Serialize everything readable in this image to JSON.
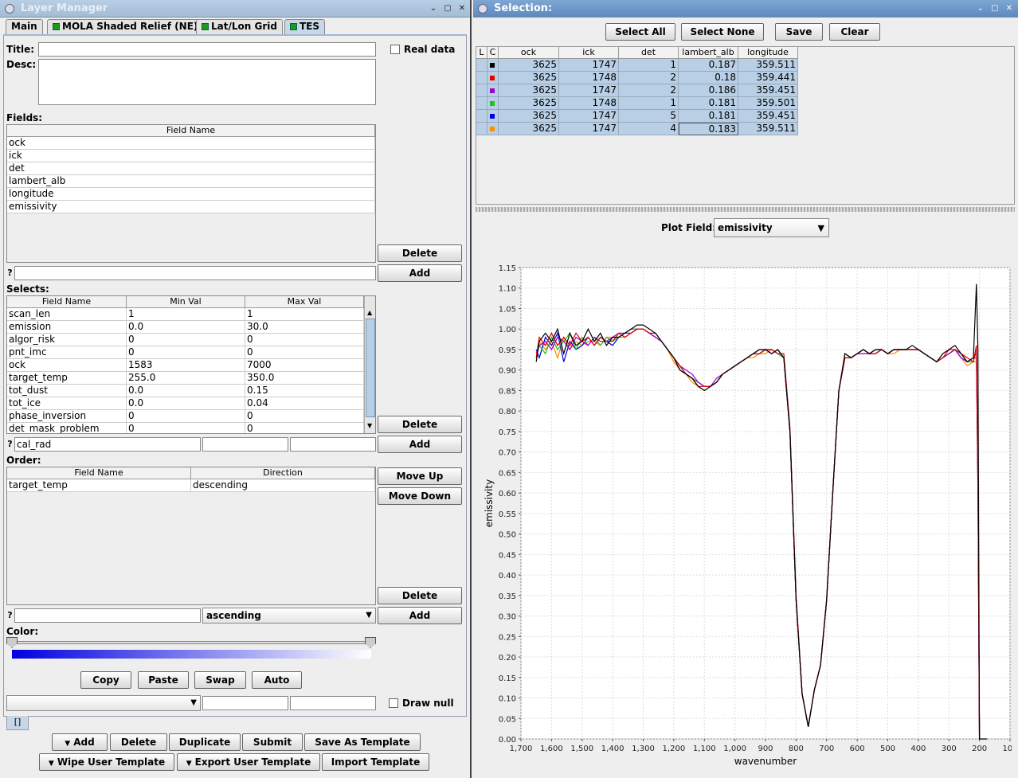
{
  "left_window": {
    "title": "Layer Manager",
    "tabs": [
      {
        "label": "Main",
        "indicator": false
      },
      {
        "label": "MOLA Shaded Relief (NE)",
        "indicator": true
      },
      {
        "label": "Lat/Lon Grid",
        "indicator": true
      },
      {
        "label": "TES",
        "indicator": true
      }
    ],
    "title_label": "Title:",
    "title_value": "",
    "real_data_label": "Real data",
    "desc_label": "Desc:",
    "fields_label": "Fields:",
    "fields_header": "Field Name",
    "fields": [
      "ock",
      "ick",
      "det",
      "lambert_alb",
      "longitude",
      "emissivity"
    ],
    "fields_delete": "Delete",
    "fields_add": "Add",
    "help_glyph": "?",
    "selects_label": "Selects:",
    "selects_headers": [
      "Field Name",
      "Min Val",
      "Max Val"
    ],
    "selects_rows": [
      [
        "scan_len",
        "1",
        "1"
      ],
      [
        "emission",
        "0.0",
        "30.0"
      ],
      [
        "algor_risk",
        "0",
        "0"
      ],
      [
        "pnt_imc",
        "0",
        "0"
      ],
      [
        "ock",
        "1583",
        "7000"
      ],
      [
        "target_temp",
        "255.0",
        "350.0"
      ],
      [
        "tot_dust",
        "0.0",
        "0.15"
      ],
      [
        "tot_ice",
        "0.0",
        "0.04"
      ],
      [
        "phase_inversion",
        "0",
        "0"
      ],
      [
        "det_mask_problem",
        "0",
        "0"
      ]
    ],
    "selects_delete": "Delete",
    "selects_add": "Add",
    "selects_input_field": "cal_rad",
    "order_label": "Order:",
    "order_headers": [
      "Field Name",
      "Direction"
    ],
    "order_rows": [
      [
        "target_temp",
        "descending"
      ]
    ],
    "order_move_up": "Move Up",
    "order_move_down": "Move Down",
    "order_delete": "Delete",
    "order_add": "Add",
    "order_direction_selected": "ascending",
    "color_label": "Color:",
    "color_buttons": [
      "Copy",
      "Paste",
      "Swap",
      "Auto"
    ],
    "draw_null_label": "Draw null",
    "bottom_tab_label": "[]",
    "bottom_row1": [
      "Add",
      "Delete",
      "Duplicate",
      "Submit",
      "Save As Template"
    ],
    "bottom_row2": [
      "Wipe User Template",
      "Export User Template",
      "Import Template"
    ],
    "colors": {
      "gradient_start": "#0000e0",
      "gradient_end": "#ffffff"
    }
  },
  "right_window": {
    "title": "Selection:",
    "buttons": [
      "Select All",
      "Select None",
      "Save",
      "Clear"
    ],
    "table_headers": [
      "L",
      "C",
      "ock",
      "ick",
      "det",
      "lambert_alb",
      "longitude"
    ],
    "table_rows": [
      {
        "color": "#000000",
        "cells": [
          "3625",
          "1747",
          "1",
          "0.187",
          "359.511"
        ]
      },
      {
        "color": "#e00000",
        "cells": [
          "3625",
          "1748",
          "2",
          "0.18",
          "359.441"
        ]
      },
      {
        "color": "#9a00d0",
        "cells": [
          "3625",
          "1747",
          "2",
          "0.186",
          "359.451"
        ]
      },
      {
        "color": "#20c020",
        "cells": [
          "3625",
          "1748",
          "1",
          "0.181",
          "359.501"
        ]
      },
      {
        "color": "#0000e0",
        "cells": [
          "3625",
          "1747",
          "5",
          "0.181",
          "359.451"
        ]
      },
      {
        "color": "#ff8c00",
        "cells": [
          "3625",
          "1747",
          "4",
          "0.183",
          "359.511"
        ]
      }
    ],
    "plot_field_label": "Plot Field:",
    "plot_field_value": "emissivity"
  },
  "chart_data": {
    "type": "line",
    "xlabel": "wavenumber",
    "ylabel": "emissivity",
    "xlim": [
      1700,
      100
    ],
    "ylim": [
      0,
      1.15
    ],
    "x_reversed": true,
    "xticks": [
      "1,700",
      "1,600",
      "1,500",
      "1,400",
      "1,300",
      "1,200",
      "1,100",
      "1,000",
      "900",
      "800",
      "700",
      "600",
      "500",
      "400",
      "300",
      "200",
      "100"
    ],
    "yticks": [
      "0.00",
      "0.05",
      "0.10",
      "0.15",
      "0.20",
      "0.25",
      "0.30",
      "0.35",
      "0.40",
      "0.45",
      "0.50",
      "0.55",
      "0.60",
      "0.65",
      "0.70",
      "0.75",
      "0.80",
      "0.85",
      "0.90",
      "0.95",
      "1.00",
      "1.05",
      "1.10",
      "1.15"
    ],
    "grid": true,
    "series": [
      {
        "color": "#000000",
        "x": [
          1650,
          1640,
          1620,
          1600,
          1580,
          1560,
          1540,
          1520,
          1500,
          1480,
          1460,
          1440,
          1420,
          1400,
          1380,
          1360,
          1340,
          1320,
          1300,
          1280,
          1260,
          1240,
          1220,
          1200,
          1180,
          1160,
          1140,
          1120,
          1100,
          1080,
          1060,
          1040,
          1020,
          1000,
          980,
          960,
          940,
          920,
          900,
          880,
          860,
          840,
          820,
          800,
          780,
          760,
          740,
          720,
          700,
          680,
          660,
          640,
          620,
          600,
          580,
          560,
          540,
          520,
          500,
          480,
          460,
          440,
          420,
          400,
          380,
          360,
          340,
          320,
          300,
          280,
          260,
          240,
          220,
          210,
          205,
          200,
          195,
          190,
          185,
          180,
          175
        ],
        "y": [
          0.92,
          0.97,
          0.99,
          0.97,
          1.0,
          0.94,
          0.99,
          0.96,
          0.97,
          1.0,
          0.97,
          0.99,
          0.96,
          0.98,
          0.98,
          0.99,
          1.0,
          1.01,
          1.01,
          1.0,
          0.99,
          0.97,
          0.95,
          0.93,
          0.9,
          0.89,
          0.88,
          0.86,
          0.85,
          0.86,
          0.87,
          0.89,
          0.9,
          0.91,
          0.92,
          0.93,
          0.94,
          0.95,
          0.95,
          0.94,
          0.95,
          0.93,
          0.75,
          0.34,
          0.11,
          0.03,
          0.12,
          0.18,
          0.34,
          0.6,
          0.85,
          0.94,
          0.93,
          0.94,
          0.95,
          0.94,
          0.95,
          0.95,
          0.94,
          0.95,
          0.95,
          0.95,
          0.96,
          0.95,
          0.94,
          0.93,
          0.92,
          0.94,
          0.95,
          0.96,
          0.94,
          0.92,
          0.93,
          1.11,
          0.95,
          0.0,
          0.0,
          0.0,
          0.0,
          0.0,
          0.0
        ]
      },
      {
        "color": "#e00000",
        "x": [
          1650,
          1640,
          1620,
          1600,
          1580,
          1560,
          1540,
          1520,
          1500,
          1480,
          1460,
          1440,
          1420,
          1400,
          1380,
          1360,
          1340,
          1320,
          1300,
          1280,
          1260,
          1240,
          1220,
          1200,
          1180,
          1160,
          1140,
          1120,
          1100,
          1080,
          1060,
          1040,
          1020,
          1000,
          980,
          960,
          940,
          920,
          900,
          880,
          860,
          840,
          820,
          800,
          780,
          760,
          740,
          720,
          700,
          680,
          660,
          640,
          620,
          600,
          580,
          560,
          540,
          520,
          500,
          480,
          460,
          440,
          420,
          400,
          380,
          360,
          340,
          320,
          300,
          280,
          260,
          240,
          220,
          210,
          205,
          200
        ],
        "y": [
          0.93,
          0.98,
          0.96,
          0.99,
          0.96,
          0.98,
          0.96,
          0.99,
          0.97,
          0.98,
          0.96,
          0.98,
          0.97,
          0.97,
          0.99,
          0.98,
          0.99,
          1.0,
          1.0,
          0.99,
          0.99,
          0.97,
          0.95,
          0.93,
          0.91,
          0.89,
          0.88,
          0.86,
          0.86,
          0.86,
          0.87,
          0.89,
          0.9,
          0.91,
          0.92,
          0.93,
          0.94,
          0.94,
          0.95,
          0.95,
          0.94,
          0.94,
          0.76,
          0.35,
          0.11,
          0.03,
          0.12,
          0.18,
          0.34,
          0.6,
          0.85,
          0.93,
          0.93,
          0.94,
          0.95,
          0.94,
          0.94,
          0.95,
          0.94,
          0.95,
          0.95,
          0.95,
          0.95,
          0.95,
          0.94,
          0.93,
          0.92,
          0.93,
          0.95,
          0.95,
          0.94,
          0.93,
          0.92,
          0.96,
          0.6,
          0.0
        ]
      },
      {
        "color": "#9a00d0",
        "x": [
          1650,
          1640,
          1620,
          1600,
          1580,
          1560,
          1540,
          1520,
          1500,
          1480,
          1460,
          1440,
          1420,
          1400,
          1380,
          1360,
          1340,
          1320,
          1300,
          1280,
          1260,
          1240,
          1220,
          1200,
          1180,
          1160,
          1140,
          1120,
          1100,
          1080,
          1060,
          1040,
          1020,
          1000,
          980,
          960,
          940,
          920,
          900,
          880,
          860,
          840,
          820,
          800,
          780,
          760,
          740,
          720,
          700,
          680,
          660,
          640,
          620,
          600,
          580,
          560,
          540,
          520,
          500,
          480,
          460,
          440,
          420,
          400,
          380,
          360,
          340,
          320,
          300,
          280,
          260,
          240,
          220,
          210,
          205,
          200
        ],
        "y": [
          0.94,
          0.96,
          0.97,
          0.95,
          0.98,
          0.97,
          0.95,
          0.98,
          0.97,
          0.96,
          0.98,
          0.97,
          0.97,
          0.98,
          0.99,
          0.99,
          0.99,
          1.0,
          1.0,
          0.99,
          0.98,
          0.97,
          0.95,
          0.93,
          0.91,
          0.9,
          0.89,
          0.87,
          0.86,
          0.86,
          0.88,
          0.89,
          0.9,
          0.91,
          0.92,
          0.93,
          0.94,
          0.95,
          0.95,
          0.94,
          0.95,
          0.93,
          0.75,
          0.34,
          0.11,
          0.03,
          0.12,
          0.18,
          0.34,
          0.6,
          0.85,
          0.94,
          0.93,
          0.94,
          0.94,
          0.94,
          0.95,
          0.95,
          0.94,
          0.95,
          0.95,
          0.95,
          0.95,
          0.95,
          0.94,
          0.93,
          0.92,
          0.93,
          0.94,
          0.95,
          0.93,
          0.92,
          0.93,
          0.94,
          0.65,
          0.0
        ]
      },
      {
        "color": "#20c020",
        "x": [
          1650,
          1640,
          1620,
          1600,
          1580,
          1560,
          1540,
          1520,
          1500,
          1480,
          1460,
          1440,
          1420,
          1400,
          1380,
          1360,
          1340,
          1320,
          1300,
          1280,
          1260,
          1240,
          1220,
          1200,
          1180,
          1160,
          1140,
          1120,
          1100,
          1080,
          1060,
          1040,
          1020,
          1000,
          980,
          960,
          940,
          920,
          900,
          880,
          860,
          840,
          820,
          800,
          780,
          760,
          740,
          720,
          700,
          680,
          660,
          640,
          620,
          600,
          580,
          560,
          540,
          520,
          500,
          480,
          460,
          440,
          420,
          400,
          380,
          360,
          340,
          320,
          300,
          280,
          260,
          240,
          220,
          210,
          205,
          200
        ],
        "y": [
          0.93,
          0.96,
          0.94,
          0.98,
          0.95,
          0.97,
          0.99,
          0.95,
          0.98,
          0.96,
          0.98,
          0.96,
          0.98,
          0.97,
          0.98,
          0.99,
          1.0,
          1.0,
          1.0,
          0.99,
          0.98,
          0.97,
          0.95,
          0.93,
          0.9,
          0.89,
          0.88,
          0.87,
          0.86,
          0.86,
          0.87,
          0.89,
          0.9,
          0.91,
          0.92,
          0.93,
          0.94,
          0.94,
          0.95,
          0.95,
          0.94,
          0.93,
          0.75,
          0.34,
          0.11,
          0.03,
          0.12,
          0.18,
          0.34,
          0.6,
          0.85,
          0.93,
          0.93,
          0.94,
          0.95,
          0.94,
          0.95,
          0.95,
          0.94,
          0.95,
          0.95,
          0.95,
          0.95,
          0.95,
          0.94,
          0.93,
          0.92,
          0.93,
          0.94,
          0.95,
          0.94,
          0.92,
          0.92,
          0.95,
          0.7,
          0.0
        ]
      },
      {
        "color": "#0000e0",
        "x": [
          1650,
          1640,
          1620,
          1600,
          1580,
          1560,
          1540,
          1520,
          1500,
          1480,
          1460,
          1440,
          1420,
          1400,
          1380,
          1360,
          1340,
          1320,
          1300,
          1280,
          1260,
          1240,
          1220,
          1200,
          1180,
          1160,
          1140,
          1120,
          1100,
          1080,
          1060,
          1040,
          1020,
          1000,
          980,
          960,
          940,
          920,
          900,
          880,
          860,
          840,
          820,
          800,
          780,
          760,
          740,
          720,
          700,
          680,
          660,
          640,
          620,
          600,
          580,
          560,
          540,
          520,
          500,
          480,
          460,
          440,
          420,
          400,
          380,
          360,
          340,
          320,
          300,
          280,
          260,
          240,
          220,
          210,
          205,
          200
        ],
        "y": [
          0.95,
          0.93,
          0.98,
          0.96,
          0.99,
          0.92,
          0.97,
          0.95,
          0.96,
          0.98,
          0.96,
          0.98,
          0.97,
          0.96,
          0.98,
          0.99,
          1.0,
          1.0,
          1.0,
          0.99,
          0.98,
          0.97,
          0.95,
          0.93,
          0.91,
          0.89,
          0.88,
          0.87,
          0.86,
          0.86,
          0.87,
          0.89,
          0.9,
          0.91,
          0.92,
          0.93,
          0.94,
          0.94,
          0.95,
          0.95,
          0.94,
          0.93,
          0.75,
          0.34,
          0.11,
          0.03,
          0.12,
          0.18,
          0.34,
          0.6,
          0.85,
          0.93,
          0.93,
          0.94,
          0.95,
          0.94,
          0.94,
          0.95,
          0.94,
          0.95,
          0.95,
          0.95,
          0.95,
          0.95,
          0.94,
          0.93,
          0.92,
          0.93,
          0.94,
          0.95,
          0.93,
          0.92,
          0.93,
          0.93,
          0.62,
          0.0
        ]
      },
      {
        "color": "#ff8c00",
        "x": [
          1650,
          1640,
          1620,
          1600,
          1580,
          1560,
          1540,
          1520,
          1500,
          1480,
          1460,
          1440,
          1420,
          1400,
          1380,
          1360,
          1340,
          1320,
          1300,
          1280,
          1260,
          1240,
          1220,
          1200,
          1180,
          1160,
          1140,
          1120,
          1100,
          1080,
          1060,
          1040,
          1020,
          1000,
          980,
          960,
          940,
          920,
          900,
          880,
          860,
          840,
          820,
          800,
          780,
          760,
          740,
          720,
          700,
          680,
          660,
          640,
          620,
          600,
          580,
          560,
          540,
          520,
          500,
          480,
          460,
          440,
          420,
          400,
          380,
          360,
          340,
          320,
          300,
          280,
          260,
          240,
          220,
          210,
          205,
          200
        ],
        "y": [
          0.94,
          0.97,
          0.95,
          0.97,
          0.93,
          0.98,
          0.95,
          0.97,
          0.96,
          0.97,
          0.97,
          0.96,
          0.98,
          0.98,
          0.98,
          0.98,
          0.99,
          1.0,
          1.0,
          0.99,
          0.98,
          0.97,
          0.95,
          0.92,
          0.9,
          0.89,
          0.87,
          0.86,
          0.85,
          0.86,
          0.87,
          0.89,
          0.9,
          0.91,
          0.92,
          0.93,
          0.93,
          0.94,
          0.94,
          0.95,
          0.94,
          0.93,
          0.75,
          0.34,
          0.11,
          0.03,
          0.12,
          0.18,
          0.34,
          0.6,
          0.85,
          0.93,
          0.93,
          0.94,
          0.94,
          0.94,
          0.94,
          0.95,
          0.94,
          0.94,
          0.95,
          0.95,
          0.95,
          0.95,
          0.94,
          0.93,
          0.92,
          0.93,
          0.94,
          0.95,
          0.93,
          0.91,
          0.92,
          0.92,
          0.7,
          0.0
        ]
      }
    ]
  }
}
